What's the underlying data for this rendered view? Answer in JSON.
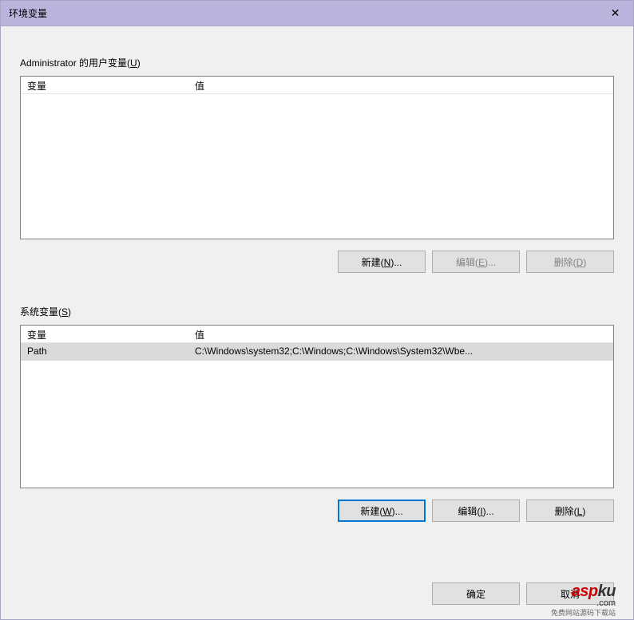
{
  "window": {
    "title": "环境变量"
  },
  "userVars": {
    "label_prefix": "Administrator 的用户变量(",
    "label_hotkey": "U",
    "label_suffix": ")",
    "header_name": "变量",
    "header_value": "值",
    "rows": [],
    "buttons": {
      "new_prefix": "新建(",
      "new_hotkey": "N",
      "new_suffix": ")...",
      "edit_prefix": "编辑(",
      "edit_hotkey": "E",
      "edit_suffix": ")...",
      "delete_prefix": "删除(",
      "delete_hotkey": "D",
      "delete_suffix": ")"
    }
  },
  "systemVars": {
    "label_prefix": "系统变量(",
    "label_hotkey": "S",
    "label_suffix": ")",
    "header_name": "变量",
    "header_value": "值",
    "rows": [
      {
        "name": "Path",
        "value": "C:\\Windows\\system32;C:\\Windows;C:\\Windows\\System32\\Wbe..."
      }
    ],
    "buttons": {
      "new_prefix": "新建(",
      "new_hotkey": "W",
      "new_suffix": ")...",
      "edit_prefix": "编辑(",
      "edit_hotkey": "I",
      "edit_suffix": ")...",
      "delete_prefix": "删除(",
      "delete_hotkey": "L",
      "delete_suffix": ")"
    }
  },
  "dialog": {
    "ok": "确定",
    "cancel": "取消"
  },
  "watermark": {
    "asp": "asp",
    "ku": "ku",
    "com": ".com",
    "sub": "免费网站源码下载站"
  }
}
